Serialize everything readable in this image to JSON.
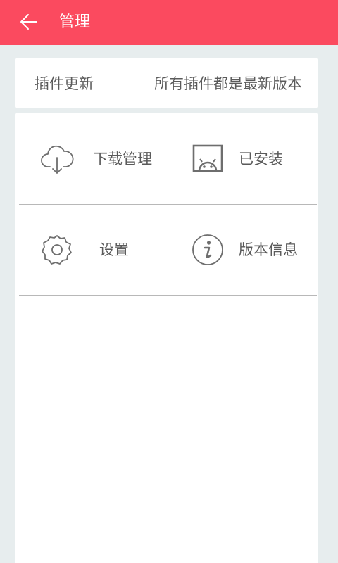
{
  "header": {
    "title": "管理",
    "back_icon": "arrow-left-icon",
    "color": "#fb4a5f"
  },
  "plugin_update": {
    "label": "插件更新",
    "status": "所有插件都是最新版本"
  },
  "menu": {
    "items": [
      {
        "label": "下载管理",
        "icon": "cloud-download-icon"
      },
      {
        "label": "已安装",
        "icon": "android-installed-icon"
      },
      {
        "label": "设置",
        "icon": "gear-icon"
      },
      {
        "label": "版本信息",
        "icon": "info-icon"
      }
    ]
  },
  "colors": {
    "background": "#e7edee",
    "text": "#5a5a5a",
    "divider": "#b8b8b8",
    "icon": "#6e6e6e"
  }
}
